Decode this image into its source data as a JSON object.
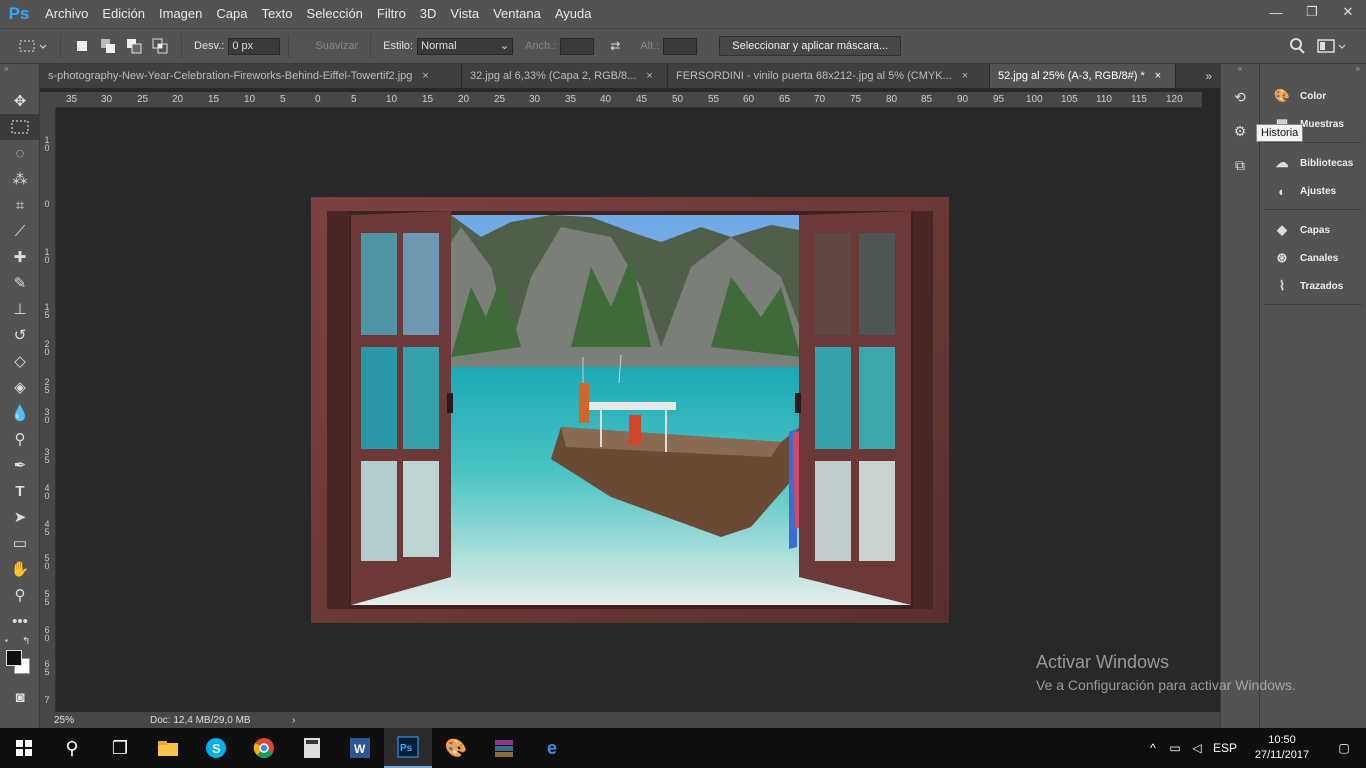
{
  "app": {
    "logo": "Ps"
  },
  "menu": [
    "Archivo",
    "Edición",
    "Imagen",
    "Capa",
    "Texto",
    "Selección",
    "Filtro",
    "3D",
    "Vista",
    "Ventana",
    "Ayuda"
  ],
  "window_controls": {
    "minimize": "—",
    "restore": "❐",
    "close": "✕"
  },
  "options": {
    "feather_label": "Desv.:",
    "feather_value": "0 px",
    "antialias_label": "Suavizar",
    "style_label": "Estilo:",
    "style_value": "Normal",
    "width_label": "Anch.:",
    "height_label": "Alt.:",
    "mask_button": "Seleccionar y aplicar máscara..."
  },
  "tabs": [
    {
      "label": "s-photography-New-Year-Celebration-Fireworks-Behind-Eiffel-Towertif2.jpg",
      "close": "×"
    },
    {
      "label": "32.jpg al 6,33% (Capa 2, RGB/8...",
      "close": "×"
    },
    {
      "label": "FERSORDINI  - vinilo puerta 68x212-.jpg al 5% (CMYK...",
      "close": "×"
    },
    {
      "label": "52.jpg al 25% (A-3, RGB/8#) *",
      "close": "×"
    }
  ],
  "tabs_overflow": "»",
  "ruler_top": [
    "35",
    "30",
    "25",
    "20",
    "15",
    "10",
    "5",
    "0",
    "5",
    "10",
    "15",
    "20",
    "25",
    "30",
    "35",
    "40",
    "45",
    "50",
    "55",
    "60",
    "65",
    "70",
    "75",
    "80",
    "85",
    "90",
    "95",
    "100",
    "105",
    "110",
    "115",
    "120"
  ],
  "ruler_left": [
    "1 0",
    "0",
    "1 0",
    "1 5",
    "2 0",
    "2 5",
    "3 0",
    "3 5",
    "4 0",
    "4 5",
    "5 0",
    "5 5",
    "6 0",
    "6 5",
    "7"
  ],
  "status": {
    "zoom": "25%",
    "doc": "Doc: 12,4 MB/29,0 MB",
    "arrow": "›"
  },
  "panels": [
    {
      "label": "Color",
      "icon": "color-icon"
    },
    {
      "label": "Muestras",
      "icon": "swatches-icon"
    },
    {
      "label": "Bibliotecas",
      "icon": "libraries-icon"
    },
    {
      "label": "Ajustes",
      "icon": "adjustments-icon"
    },
    {
      "label": "Capas",
      "icon": "layers-icon"
    },
    {
      "label": "Canales",
      "icon": "channels-icon"
    },
    {
      "label": "Trazados",
      "icon": "paths-icon"
    }
  ],
  "tooltip": "Historia",
  "watermark": {
    "title": "Activar Windows",
    "subtitle": "Ve a Configuración para activar Windows."
  },
  "tray": {
    "language": "ESP",
    "time": "10:50",
    "date": "27/11/2017"
  },
  "colors": {
    "ps_blue": "#31a8ff",
    "chrome": "#535353",
    "canvas_bg": "#282828",
    "frame": "#6d3a38"
  }
}
